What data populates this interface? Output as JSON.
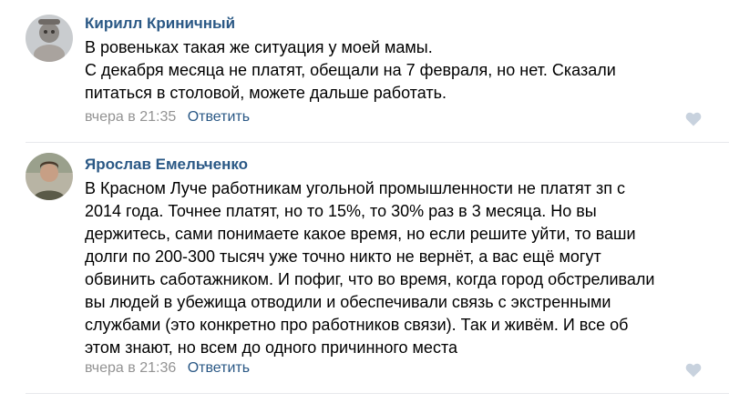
{
  "comments": [
    {
      "author": "Кирилл Криничный",
      "text_lines": [
        "В ровеньках такая же ситуация у моей мамы.",
        "С декабря месяца не платят, обещали на 7 февраля, но нет. Сказали",
        "питаться в столовой, можете дальше работать."
      ],
      "time": "вчера в 21:35",
      "reply_label": "Ответить",
      "like_icon": "heart-icon"
    },
    {
      "author": "Ярослав Емельченко",
      "text_lines": [
        "В Красном Луче работникам угольной промышленности не платят зп с",
        "2014 года. Точнее платят, но то 15%, то 30% раз в 3 месяца. Но вы",
        "держитесь, сами понимаете какое время, но если решите уйти, то ваши",
        "долги по 200-300 тысяч уже точно никто не вернёт, а вас ещё могут",
        "обвинить саботажником. И пофиг, что во время, когда город обстреливали",
        "вы людей в убежища отводили и обеспечивали связь с экстренными",
        "службами (это конкретно про работников связи). Так и живём. И все об",
        "этом знают, но всем до одного причинного места"
      ],
      "time": "вчера в 21:36",
      "reply_label": "Ответить",
      "like_icon": "heart-icon"
    }
  ],
  "colors": {
    "author_link": "#2a5885",
    "meta_time": "#939393",
    "like_heart": "#c8d2de",
    "divider": "#e7e8ec"
  }
}
